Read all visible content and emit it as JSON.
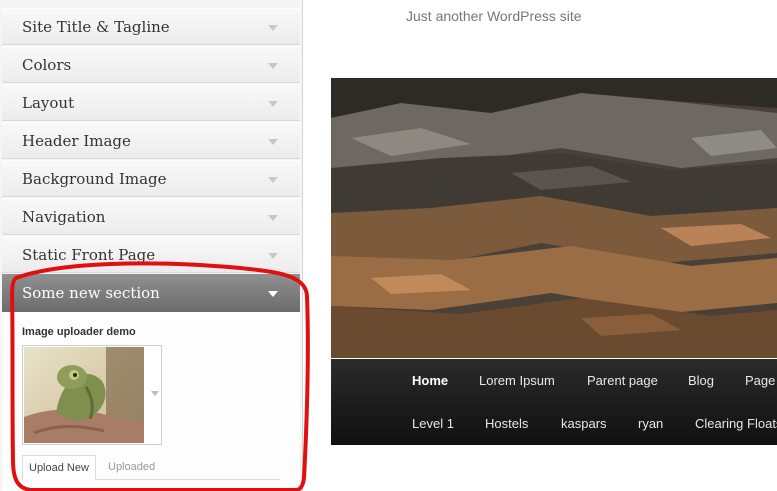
{
  "sidebar": {
    "sections": [
      {
        "label": "Site Title & Tagline"
      },
      {
        "label": "Colors"
      },
      {
        "label": "Layout"
      },
      {
        "label": "Header Image"
      },
      {
        "label": "Background Image"
      },
      {
        "label": "Navigation"
      },
      {
        "label": "Static Front Page"
      }
    ],
    "open_section": {
      "label": "Some new section",
      "control_title": "Image uploader demo",
      "tabs": {
        "upload": "Upload New",
        "uploaded": "Uploaded"
      }
    }
  },
  "preview": {
    "tagline": "Just another WordPress site",
    "menu_row1": [
      {
        "label": "Home"
      },
      {
        "label": "Lorem Ipsum"
      },
      {
        "label": "Parent page"
      },
      {
        "label": "Blog"
      },
      {
        "label": "Page"
      }
    ],
    "menu_row2": [
      {
        "label": "Level 1"
      },
      {
        "label": "Hostels"
      },
      {
        "label": "kaspars"
      },
      {
        "label": "ryan"
      },
      {
        "label": "Clearing Floats"
      }
    ]
  },
  "colors": {
    "annotation": "#e01010",
    "menu_bg": "#1a1a1a",
    "open_section_bg": "#7a7a7a"
  }
}
